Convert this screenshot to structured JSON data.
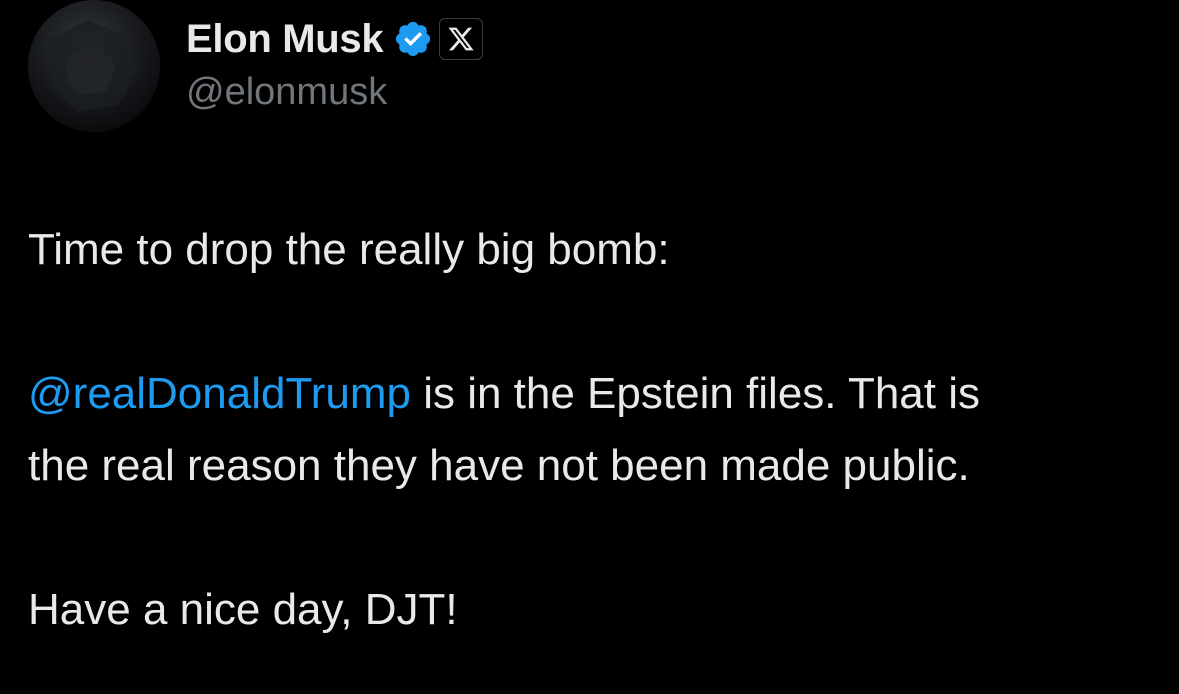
{
  "author": {
    "display_name": "Elon Musk",
    "handle": "@elonmusk",
    "verified": true,
    "verified_color": "#1d9bf0",
    "affiliation_icon": "x-logo-icon"
  },
  "tweet": {
    "line1": "Time to drop the really big bomb:",
    "mention": "@realDonaldTrump",
    "line2_rest": " is in the Epstein files. That is",
    "line3": "the real reason they have not been made public.",
    "line4": "Have a nice day, DJT!",
    "mention_color": "#1d9bf0"
  },
  "theme": {
    "background": "#000000",
    "text": "#e7e9ea",
    "secondary_text": "#71767b"
  }
}
